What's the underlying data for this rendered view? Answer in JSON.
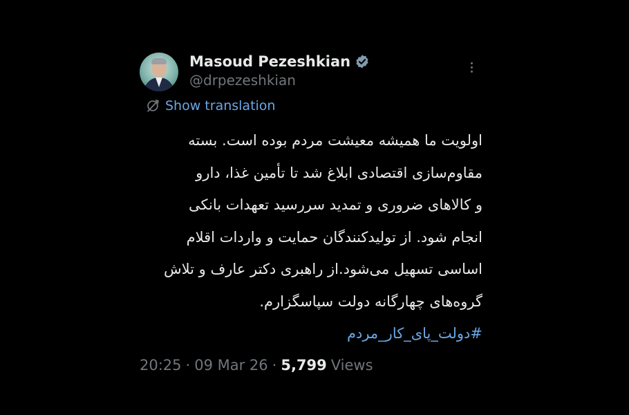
{
  "tweet": {
    "author_name": "Masoud Pezeshkian",
    "handle": "@drpezeshkian",
    "verified_icon": "verified-badge-icon",
    "more_icon": "more-options-icon",
    "translate_label": "Show translation",
    "body_lines": [
      "اولویت ما همیشه معیشت مردم بوده است. بسته",
      "مقاوم‌سازی اقتصادی ابلاغ شد تا تأمین غذا، دارو",
      "و کالاهای ضروری و تمدید سررسید تعهدات بانکی",
      "انجام شود. از تولیدکنندگان حمایت و واردات اقلام",
      "اساسی تسهیل می‌شود.از راهبری دکتر عارف و تلاش",
      "گروه‌های چهارگانه دولت سپاسگزارم."
    ],
    "hashtag": "#دولت_پای_کار_مردم",
    "time": "20:25",
    "date": "09 Mar 26",
    "separator": "·",
    "views_count": "5,799",
    "views_label": "Views"
  },
  "colors": {
    "background": "#000000",
    "text_primary": "#e7e9ea",
    "text_secondary": "#71767b",
    "link": "#6aa7e6",
    "verified": "#829aab"
  }
}
